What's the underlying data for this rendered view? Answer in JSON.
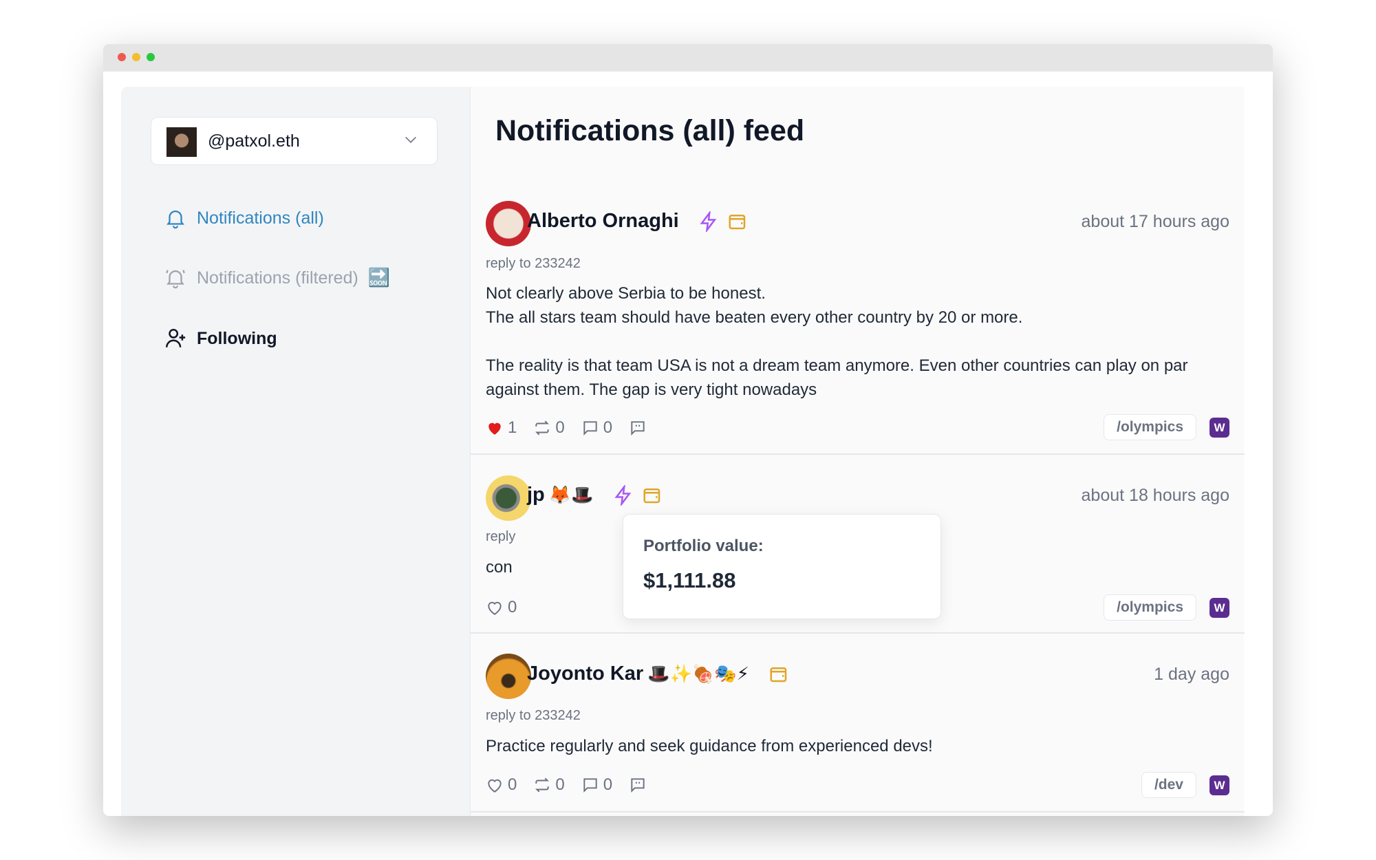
{
  "window": {
    "traffic_lights": [
      "#ee5a52",
      "#f5bd2f",
      "#28c840"
    ]
  },
  "sidebar": {
    "account": {
      "handle": "@patxol.eth"
    },
    "items": [
      {
        "label": "Notifications (all)",
        "icon": "bell-icon",
        "active": true,
        "color": "#2e86c1"
      },
      {
        "label": "Notifications (filtered)",
        "icon": "bell-ringing-icon",
        "badge": "🔜",
        "color": "#9ca3af"
      },
      {
        "label": "Following",
        "icon": "user-plus-icon",
        "color": "#111827"
      }
    ]
  },
  "main": {
    "title": "Notifications (all) feed",
    "refresh_icon": "refresh-icon",
    "posts": [
      {
        "author": "Alberto Ornaghi",
        "badges": "",
        "time": "about 17 hours ago",
        "reply": "reply to 233242",
        "body": "Not clearly above Serbia to be honest.\nThe all stars team should have beaten every other country by 20 or more.\n\nThe reality is that team USA is not a dream team anymore. Even other countries can play on par against them. The gap is very tight nowadays",
        "likes": "1",
        "liked": true,
        "recasts": "0",
        "replies": "0",
        "channel": "/olympics",
        "client_badge": "W"
      },
      {
        "author": "jp",
        "badges": "🦊🎩",
        "time": "about 18 hours ago",
        "reply": "reply",
        "body": "con",
        "likes": "0",
        "liked": false,
        "channel": "/olympics",
        "client_badge": "W"
      },
      {
        "author": "Joyonto Kar",
        "badges": "🎩✨🍖🎭⚡",
        "time": "1 day ago",
        "reply": "reply to 233242",
        "body": "Practice regularly and seek guidance from experienced devs!",
        "likes": "0",
        "liked": false,
        "recasts": "0",
        "replies": "0",
        "channel": "/dev",
        "client_badge": "W"
      }
    ],
    "tooltip": {
      "label": "Portfolio value:",
      "value": "$1,111.88"
    }
  },
  "colors": {
    "power_badge": "#a855f7",
    "wallet": "#e0a526",
    "heart": "#e11d1d"
  }
}
